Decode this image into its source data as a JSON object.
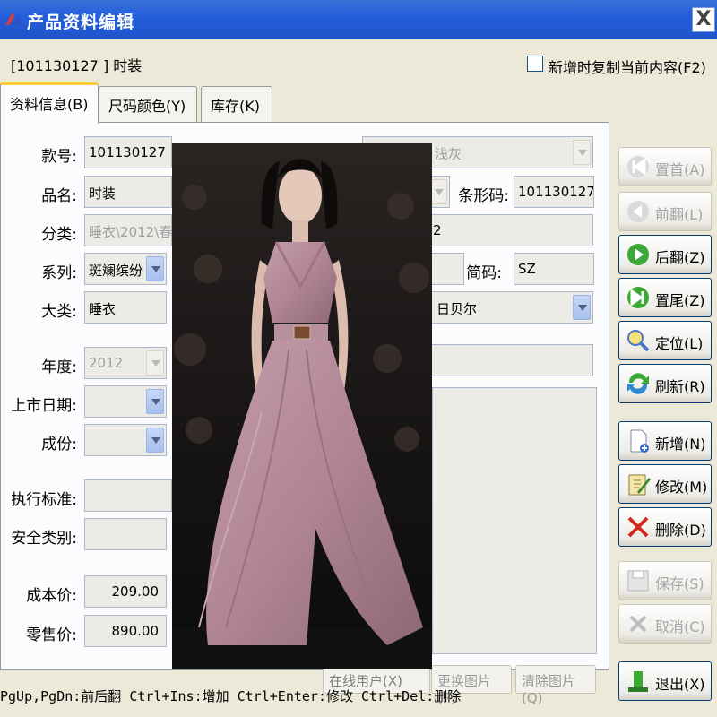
{
  "window": {
    "title": "产品资料编辑",
    "close_glyph": "X"
  },
  "header": {
    "code_text": "[101130127       ] 时装",
    "copy_checkbox_label": "新增时复制当前内容(F2)",
    "copy_checked": false
  },
  "tabs": [
    {
      "label": "资料信息(B)",
      "active": true
    },
    {
      "label": "尺码颜色(Y)",
      "active": false
    },
    {
      "label": "库存(K)",
      "active": false
    }
  ],
  "form": {
    "style_no": {
      "label": "款号:",
      "value": "101130127"
    },
    "name": {
      "label": "品名:",
      "value": "时装"
    },
    "category": {
      "label": "分类:",
      "value": "睡衣\\2012\\春"
    },
    "series": {
      "label": "系列:",
      "value": "斑斓缤纷"
    },
    "major_class": {
      "label": "大类:",
      "value": "睡衣"
    },
    "year": {
      "label": "年度:",
      "value": "2012"
    },
    "launch_date": {
      "label": "上市日期:",
      "value": ""
    },
    "composition": {
      "label": "成份:",
      "value": ""
    },
    "standard": {
      "label": "执行标准:",
      "value": ""
    },
    "safety_class": {
      "label": "安全类别:",
      "value": ""
    },
    "cost_price": {
      "label": "成本价:",
      "value": "209.00"
    },
    "retail_price": {
      "label": "零售价:",
      "value": "890.00"
    },
    "color_value": "浅灰",
    "barcode": {
      "label": "条形码:",
      "value": "101130127"
    },
    "row3_value": "2",
    "short_code": {
      "label": "简码:",
      "value": "SZ"
    },
    "brand_value": "日贝尔"
  },
  "picture_buttons": {
    "replace": "更换图片(P)",
    "clear": "清除图片(Q)",
    "behind_text": "在线用户(X)"
  },
  "actions": [
    {
      "label": "置首(A)",
      "icon": "first-record-icon",
      "enabled": false
    },
    {
      "label": "前翻(L)",
      "icon": "prev-record-icon",
      "enabled": false
    },
    {
      "label": "后翻(Z)",
      "icon": "next-record-icon",
      "enabled": true
    },
    {
      "label": "置尾(Z)",
      "icon": "last-record-icon",
      "enabled": true
    },
    {
      "label": "定位(L)",
      "icon": "locate-icon",
      "enabled": true
    },
    {
      "label": "刷新(R)",
      "icon": "refresh-icon",
      "enabled": true
    },
    {
      "label": "新增(N)",
      "icon": "new-document-icon",
      "enabled": true
    },
    {
      "label": "修改(M)",
      "icon": "edit-icon",
      "enabled": true
    },
    {
      "label": "删除(D)",
      "icon": "delete-icon",
      "enabled": true
    },
    {
      "label": "保存(S)",
      "icon": "save-icon",
      "enabled": false
    },
    {
      "label": "取消(C)",
      "icon": "cancel-icon",
      "enabled": false
    },
    {
      "label": "退出(X)",
      "icon": "exit-icon",
      "enabled": true
    }
  ],
  "status_text": "PgUp,PgDn:前后翻 Ctrl+Ins:增加 Ctrl+Enter:修改 Ctrl+Del:删除",
  "colors": {
    "title_bar": "#245edb",
    "panel": "#fcfcfe",
    "dress": "#b98a9b"
  }
}
